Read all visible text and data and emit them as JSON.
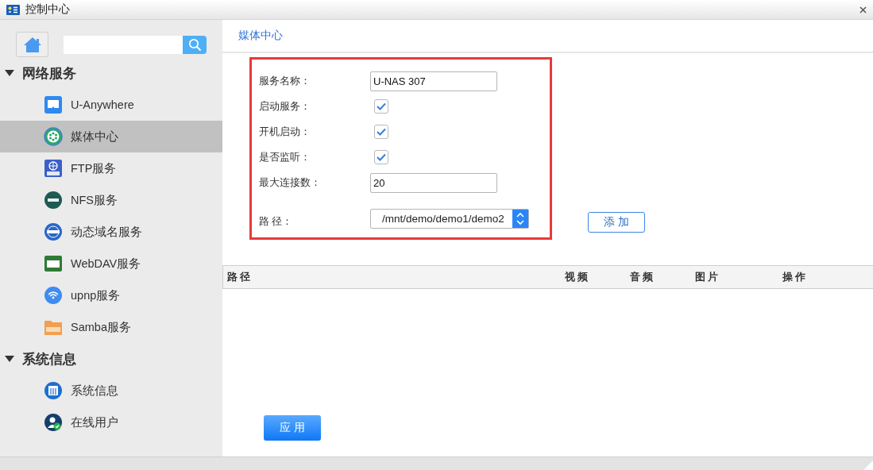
{
  "window": {
    "title": "控制中心"
  },
  "sidebar": {
    "sections": [
      {
        "label": "网络服务",
        "expanded": true,
        "items": [
          {
            "label": "U-Anywhere",
            "selected": false
          },
          {
            "label": "媒体中心",
            "selected": true
          },
          {
            "label": "FTP服务",
            "selected": false
          },
          {
            "label": "NFS服务",
            "selected": false
          },
          {
            "label": "动态域名服务",
            "selected": false
          },
          {
            "label": "WebDAV服务",
            "selected": false
          },
          {
            "label": "upnp服务",
            "selected": false
          },
          {
            "label": "Samba服务",
            "selected": false
          }
        ]
      },
      {
        "label": "系统信息",
        "expanded": true,
        "items": [
          {
            "label": "系统信息",
            "selected": false
          },
          {
            "label": "在线用户",
            "selected": false
          }
        ]
      }
    ]
  },
  "page": {
    "title": "媒体中心",
    "form": [
      {
        "kind": "text",
        "label": "服务名称：",
        "value": "U-NAS 307"
      },
      {
        "kind": "checkbox",
        "label": "启动服务：",
        "checked": true
      },
      {
        "kind": "checkbox",
        "label": "开机启动：",
        "checked": true
      },
      {
        "kind": "checkbox",
        "label": "是否监听：",
        "checked": true
      },
      {
        "kind": "text",
        "label": "最大连接数：",
        "value": "20"
      },
      {
        "kind": "select",
        "label": "路 径：",
        "value": "/mnt/demo/demo1/demo2"
      }
    ],
    "add_button": "添 加",
    "table": {
      "columns": [
        "路 径",
        "视 频",
        "音 频",
        "图 片",
        "操 作"
      ]
    },
    "apply_button": "应 用"
  }
}
